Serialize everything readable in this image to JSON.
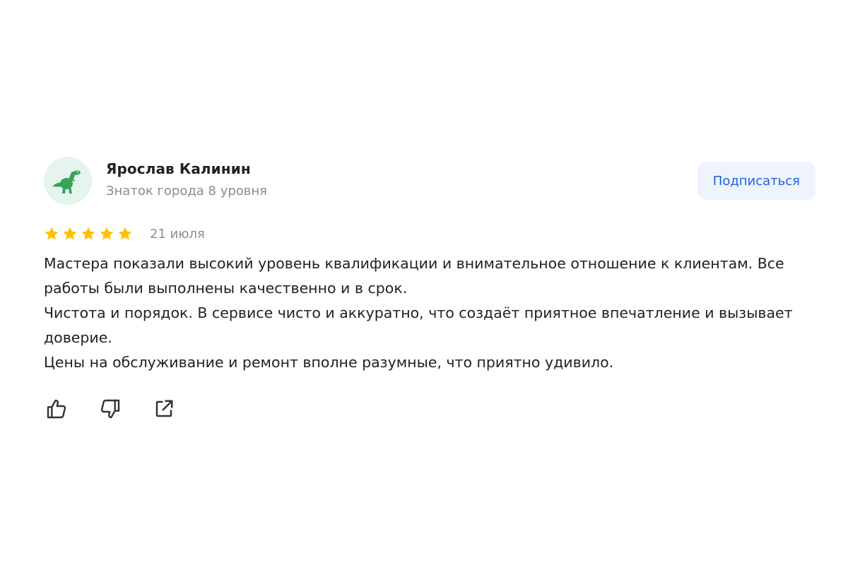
{
  "author": {
    "name": "Ярослав Калинин",
    "level": "Знаток города 8 уровня",
    "avatar_icon": "dinosaur-icon",
    "avatar_bg": "#e6f4ee"
  },
  "subscribe": {
    "label": "Подписаться",
    "color": "#1e62e6",
    "bg": "#eef3fc"
  },
  "rating": {
    "value": 5,
    "max": 5,
    "star_color": "#fcc200"
  },
  "date": "21 июля",
  "text": [
    "Мастера показали высокий уровень квалификации и внимательное отношение к клиентам. Все работы были выполнены качественно и в срок.",
    "Чистота и порядок. В сервисе чисто и аккуратно, что создаёт приятное впечатление и вызывает доверие.",
    "Цены на обслуживание и ремонт вполне разумные, что приятно удивило."
  ],
  "actions": [
    {
      "icon": "thumbs-up-icon"
    },
    {
      "icon": "thumbs-down-icon"
    },
    {
      "icon": "share-icon"
    }
  ]
}
